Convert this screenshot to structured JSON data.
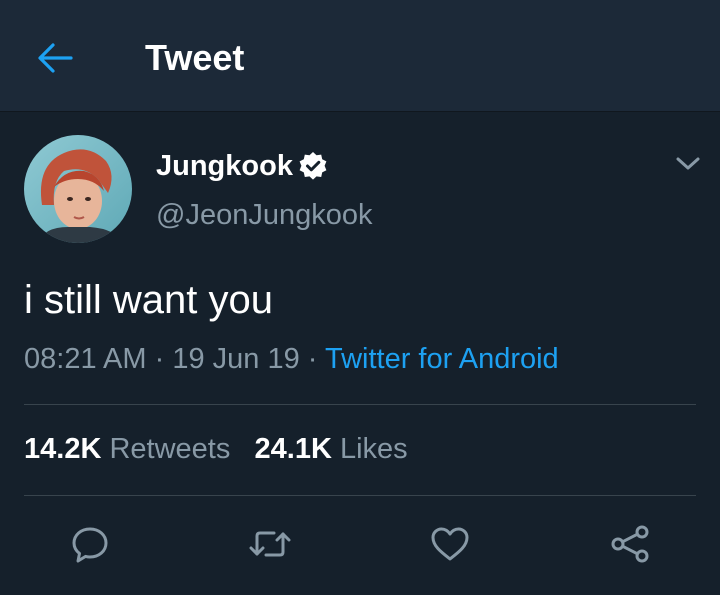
{
  "header": {
    "title": "Tweet",
    "back_icon": "arrow-left-icon"
  },
  "author": {
    "display_name": "Jungkook",
    "handle": "@JeonJungkook",
    "verified": true,
    "verified_icon": "verified-badge-icon"
  },
  "tweet": {
    "text": "i still want you",
    "time": "08:21 AM",
    "date": "19 Jun 19",
    "source": "Twitter for Android"
  },
  "stats": {
    "retweets_count": "14.2K",
    "retweets_label": "Retweets",
    "likes_count": "24.1K",
    "likes_label": "Likes"
  },
  "actions": [
    "reply-icon",
    "retweet-icon",
    "like-icon",
    "share-icon"
  ],
  "colors": {
    "background": "#15202b",
    "header": "#1c2938",
    "accent": "#1da1f2",
    "secondary_text": "#8899a6",
    "divider": "#38444d"
  }
}
